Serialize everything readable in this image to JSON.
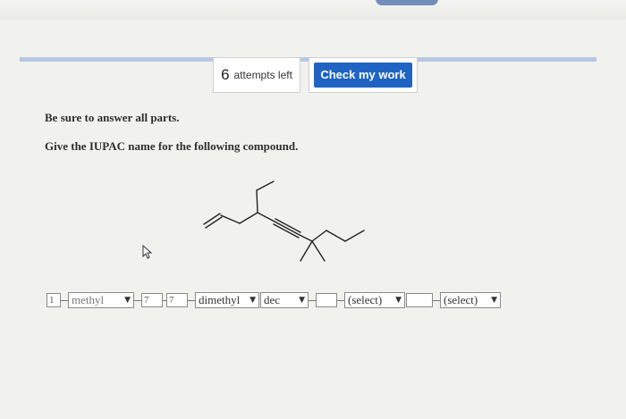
{
  "header": {
    "attempts_count": "6",
    "attempts_label": "attempts left",
    "check_button_label": "Check my work"
  },
  "question": {
    "instruction": "Be sure to answer all parts.",
    "prompt": "Give the IUPAC name for the following compound."
  },
  "answer": {
    "locant1": "1",
    "substituent1": "methyl",
    "locant2": "7",
    "locant3": "7",
    "substituent2": "dimethyl",
    "parent": "dec",
    "locant4": "",
    "select1": "(select)",
    "locant5": "",
    "select2": "(select)"
  },
  "icons": {
    "cursor": "mouse-pointer-icon",
    "chevron": "chevron-down-icon"
  }
}
